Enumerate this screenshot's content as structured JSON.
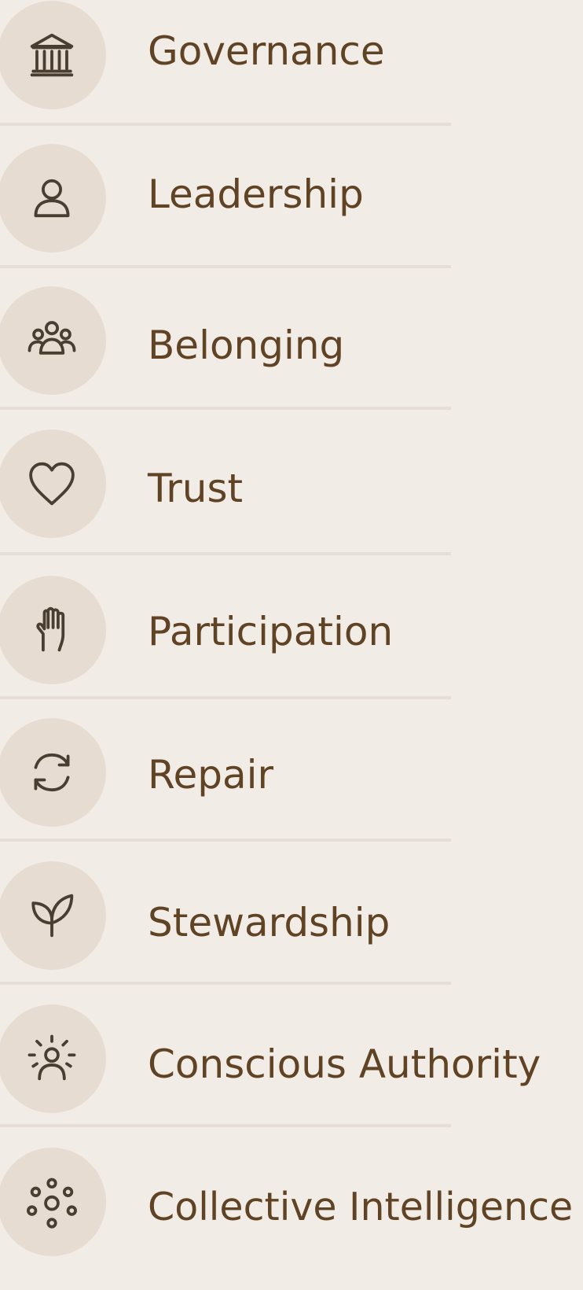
{
  "menu": {
    "items": [
      {
        "label": "Governance",
        "icon": "bank-icon"
      },
      {
        "label": "Leadership",
        "icon": "person-icon"
      },
      {
        "label": "Belonging",
        "icon": "group-icon"
      },
      {
        "label": "Trust",
        "icon": "heart-icon"
      },
      {
        "label": "Participation",
        "icon": "raised-hand-icon"
      },
      {
        "label": "Repair",
        "icon": "refresh-cycle-icon"
      },
      {
        "label": "Stewardship",
        "icon": "leaf-sprout-icon"
      },
      {
        "label": "Conscious Authority",
        "icon": "radiant-person-icon"
      },
      {
        "label": "Collective Intelligence",
        "icon": "network-cluster-icon"
      }
    ]
  },
  "colors": {
    "background": "#f2ece6",
    "icon_circle": "#e6dcd2",
    "label_text": "#5f4324",
    "divider": "#e6ded6",
    "icon_stroke": "#4a3e30"
  }
}
